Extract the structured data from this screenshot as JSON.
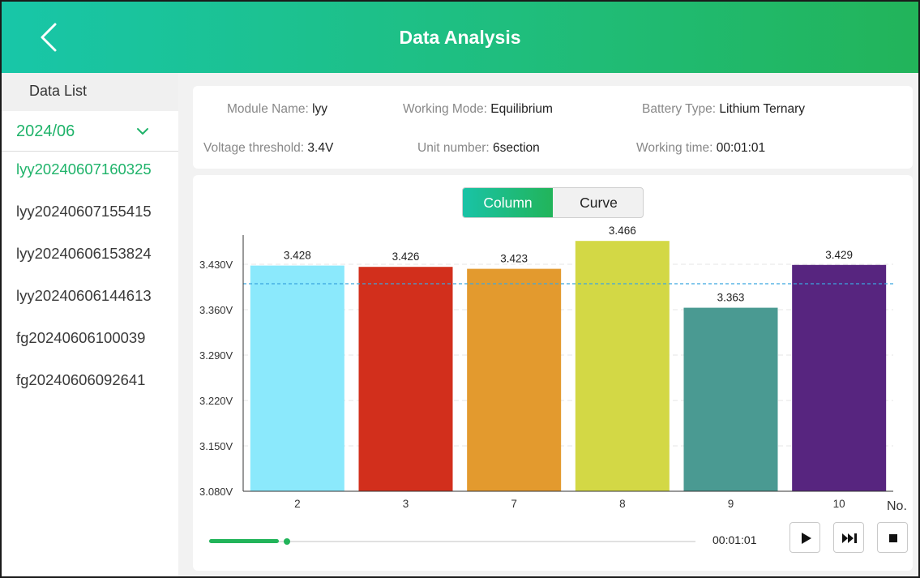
{
  "header": {
    "title": "Data Analysis"
  },
  "sidebar": {
    "title": "Data List",
    "month": "2024/06",
    "files": [
      {
        "name": "lyy20240607160325",
        "active": true
      },
      {
        "name": "lyy20240607155415",
        "active": false
      },
      {
        "name": "lyy20240606153824",
        "active": false
      },
      {
        "name": "lyy20240606144613",
        "active": false
      },
      {
        "name": "fg20240606100039",
        "active": false
      },
      {
        "name": "fg20240606092641",
        "active": false
      }
    ]
  },
  "info": {
    "module_name_label": "Module Name: ",
    "module_name": "lyy",
    "working_mode_label": "Working Mode: ",
    "working_mode": "Equilibrium",
    "battery_type_label": "Battery Type: ",
    "battery_type": "Lithium Ternary",
    "voltage_threshold_label": "Voltage threshold: ",
    "voltage_threshold": "3.4V",
    "unit_number_label": "Unit number: ",
    "unit_number": "6section",
    "working_time_label": "Working time: ",
    "working_time": "00:01:01"
  },
  "toggle": {
    "column": "Column",
    "curve": "Curve",
    "selected": "Column"
  },
  "chart_data": {
    "type": "bar",
    "categories": [
      "2",
      "3",
      "7",
      "8",
      "9",
      "10"
    ],
    "values": [
      3.428,
      3.426,
      3.423,
      3.466,
      3.363,
      3.429
    ],
    "value_labels": [
      "3.428",
      "3.426",
      "3.423",
      "3.466",
      "3.363",
      "3.429"
    ],
    "colors": [
      "#8be9fc",
      "#d22f1c",
      "#e39a2e",
      "#d3d845",
      "#4a9a92",
      "#57257f"
    ],
    "yticks": [
      3.08,
      3.15,
      3.22,
      3.29,
      3.36,
      3.43
    ],
    "ytick_labels": [
      "3.080V",
      "3.150V",
      "3.220V",
      "3.290V",
      "3.360V",
      "3.430V"
    ],
    "ylim": [
      3.08,
      3.43
    ],
    "threshold": 3.4,
    "threshold_color": "#3ba6e0",
    "xlabel": "No.",
    "grid": true
  },
  "playback": {
    "time": "00:01:01",
    "progress": 0.16
  },
  "colors": {
    "accent": "#1fb36a",
    "header_start": "#18c6a8",
    "header_end": "#22b45a"
  }
}
